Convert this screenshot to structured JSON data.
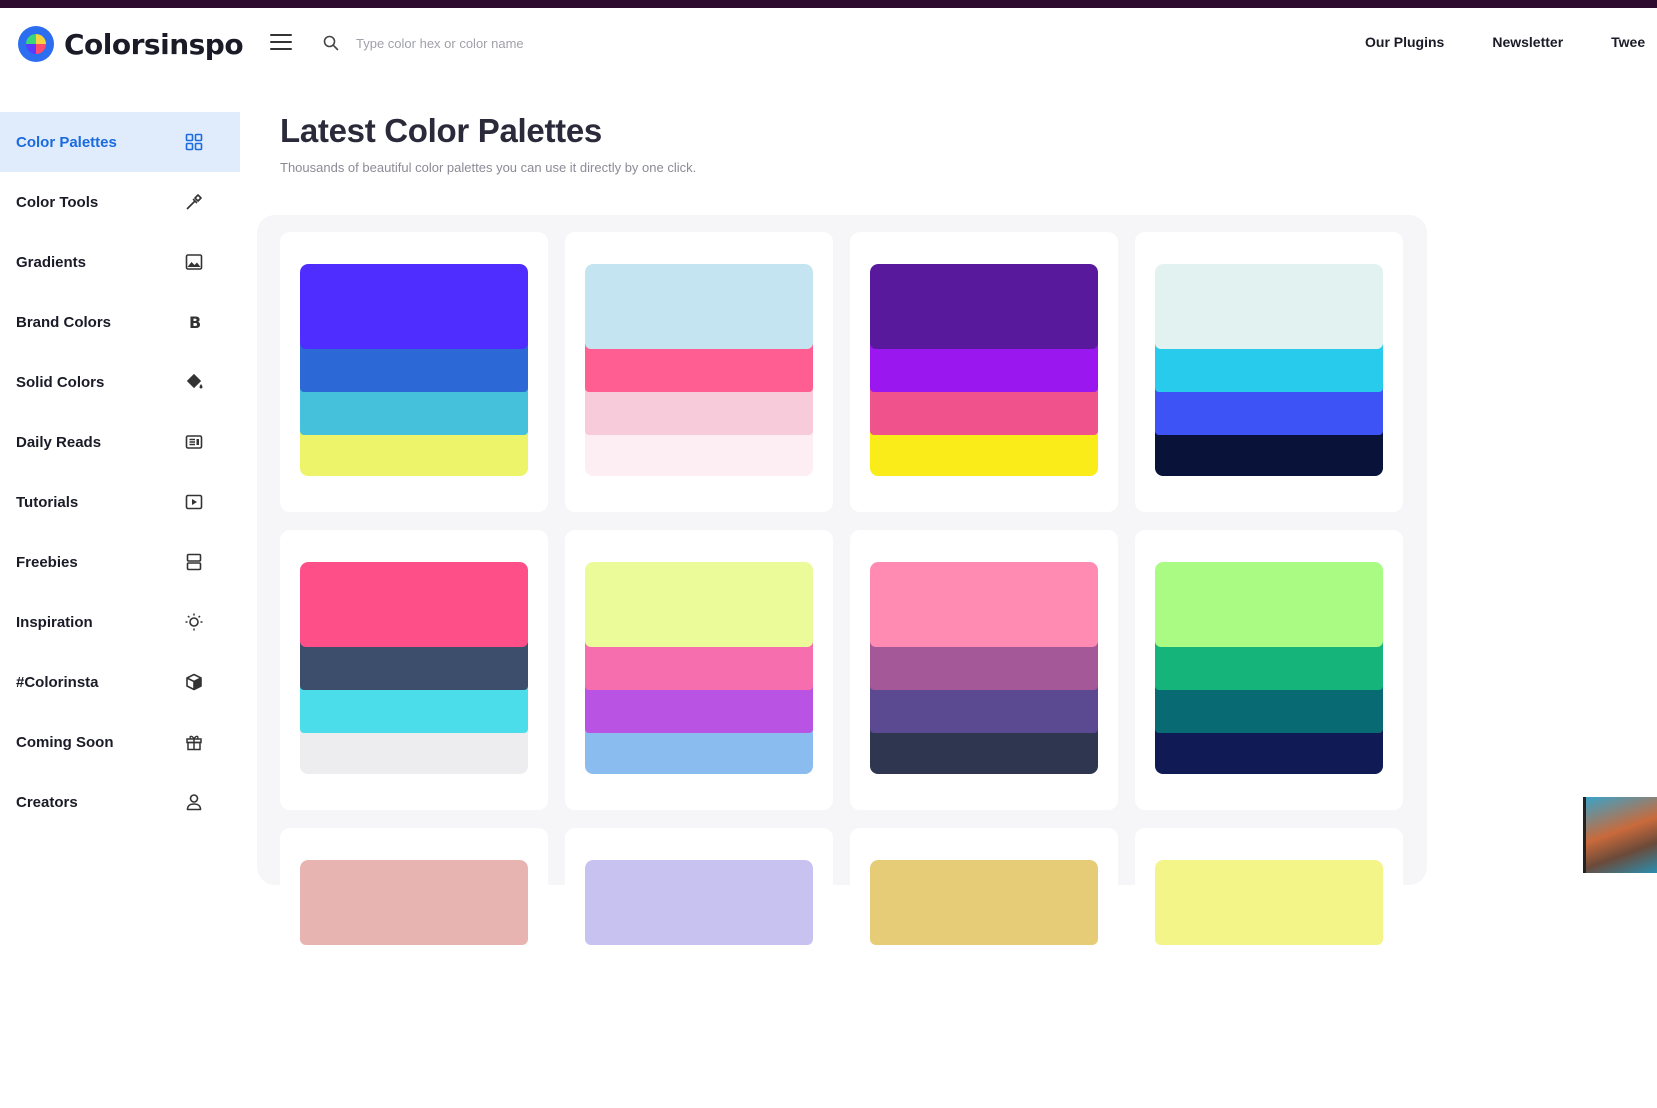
{
  "header": {
    "logo_text": "Colorsinspo",
    "search_placeholder": "Type color hex or color name",
    "nav": [
      {
        "label": "Our Plugins"
      },
      {
        "label": "Newsletter"
      },
      {
        "label": "Twee"
      }
    ]
  },
  "sidebar": {
    "items": [
      {
        "label": "Color Palettes",
        "icon": "grid-icon",
        "active": true
      },
      {
        "label": "Color Tools",
        "icon": "eyedropper-icon"
      },
      {
        "label": "Gradients",
        "icon": "image-icon"
      },
      {
        "label": "Brand Colors",
        "icon": "bold-b-icon"
      },
      {
        "label": "Solid Colors",
        "icon": "paint-bucket-icon"
      },
      {
        "label": "Daily Reads",
        "icon": "newspaper-icon"
      },
      {
        "label": "Tutorials",
        "icon": "play-icon"
      },
      {
        "label": "Freebies",
        "icon": "layout-icon"
      },
      {
        "label": "Inspiration",
        "icon": "bulb-icon"
      },
      {
        "label": "#Colorinsta",
        "icon": "cube-icon"
      },
      {
        "label": "Coming Soon",
        "icon": "gift-icon"
      },
      {
        "label": "Creators",
        "icon": "user-icon"
      }
    ]
  },
  "main": {
    "title": "Latest Color Palettes",
    "subtitle": "Thousands of beautiful color palettes you can use it directly by one click."
  },
  "palettes": [
    [
      "#4f2cff",
      "#2c69d6",
      "#45c1dc",
      "#eef46a"
    ],
    [
      "#c3e4f0",
      "#ff5e93",
      "#f8cbda",
      "#fdeef3"
    ],
    [
      "#59199d",
      "#9a17f0",
      "#f0538b",
      "#faec18"
    ],
    [
      "#e1f2f0",
      "#28cbeb",
      "#3d53f5",
      "#09133a"
    ],
    [
      "#ff4f88",
      "#3d4d6c",
      "#4bdde9",
      "#ededef"
    ],
    [
      "#ecfb9a",
      "#f66eae",
      "#b953e3",
      "#8bbcef"
    ],
    [
      "#ff8bb2",
      "#a45898",
      "#5b4a92",
      "#2f3650"
    ],
    [
      "#aafb84",
      "#15b47b",
      "#086a72",
      "#101a55"
    ],
    [
      "#e8b4b2",
      "",
      "",
      ""
    ],
    [
      "#c8c2f0",
      "",
      "",
      ""
    ],
    [
      "#e7cc78",
      "",
      "",
      ""
    ],
    [
      "#f4f589",
      "",
      "",
      ""
    ]
  ]
}
